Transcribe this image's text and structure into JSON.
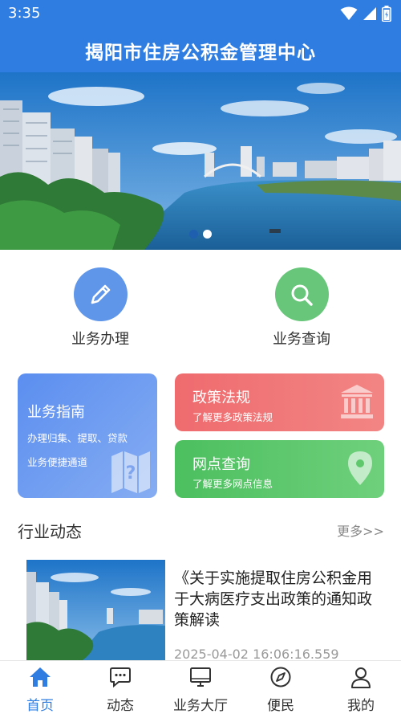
{
  "status_bar": {
    "time": "3:35"
  },
  "header": {
    "title": "揭阳市住房公积金管理中心"
  },
  "banner": {
    "slides": 2,
    "active_slide": 2
  },
  "quick_actions": {
    "handle_label": "业务办理",
    "query_label": "业务查询"
  },
  "cards": {
    "guide": {
      "title": "业务指南",
      "line1": "办理归集、提取、贷款",
      "line2": "业务便捷通道"
    },
    "policy": {
      "title": "政策法规",
      "subtitle": "了解更多政策法规"
    },
    "branch": {
      "title": "网点查询",
      "subtitle": "了解更多网点信息"
    }
  },
  "news": {
    "section_title": "行业动态",
    "more_label": "更多>>",
    "items": [
      {
        "headline": "《关于实施提取住房公积金用于大病医疗支出政策的通知政策解读",
        "time": "2025-04-02 16:06:16.559"
      }
    ]
  },
  "bottom_nav": {
    "items": [
      {
        "label": "首页",
        "icon": "home-icon",
        "active": true
      },
      {
        "label": "动态",
        "icon": "chat-icon",
        "active": false
      },
      {
        "label": "业务大厅",
        "icon": "monitor-icon",
        "active": false
      },
      {
        "label": "便民",
        "icon": "compass-icon",
        "active": false
      },
      {
        "label": "我的",
        "icon": "user-icon",
        "active": false
      }
    ]
  },
  "colors": {
    "primary": "#2f7de1",
    "handle": "#5f96ea",
    "query": "#68c67a",
    "policy": "#ef6b6e",
    "branch": "#4cbf5f"
  }
}
